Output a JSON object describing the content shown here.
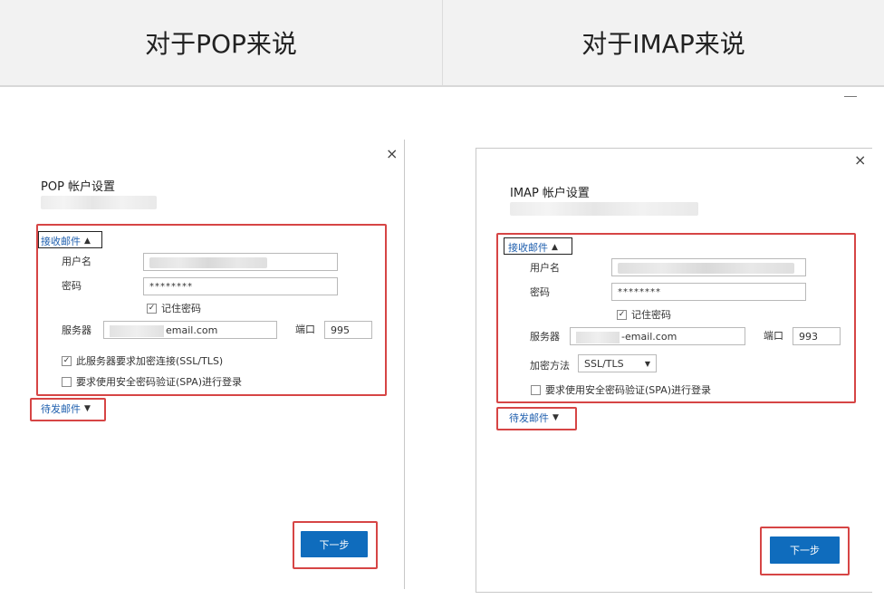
{
  "header": {
    "left": "对于POP来说",
    "right": "对于IMAP来说"
  },
  "pop": {
    "title": "POP 帐户设置",
    "incoming_label": "接收邮件",
    "username_label": "用户名",
    "password_label": "密码",
    "password_value": "********",
    "remember_label": "记住密码",
    "server_label": "服务器",
    "server_value": "email.com",
    "port_label": "端口",
    "port_value": "995",
    "ssl_label": "此服务器要求加密连接(SSL/TLS)",
    "spa_label": "要求使用安全密码验证(SPA)进行登录",
    "outgoing_label": "待发邮件",
    "next_label": "下一步",
    "close_glyph": "×"
  },
  "imap": {
    "title": "IMAP 帐户设置",
    "incoming_label": "接收邮件",
    "username_label": "用户名",
    "password_label": "密码",
    "password_value": "********",
    "remember_label": "记住密码",
    "server_label": "服务器",
    "server_value": "-email.com",
    "port_label": "端口",
    "port_value": "993",
    "encryption_label": "加密方法",
    "encryption_value": "SSL/TLS",
    "spa_label": "要求使用安全密码验证(SPA)进行登录",
    "outgoing_label": "待发邮件",
    "next_label": "下一步",
    "close_glyph": "×"
  },
  "colors": {
    "highlight_red": "#d64545",
    "button_blue": "#0f6cbd",
    "link_blue": "#1f5fae"
  },
  "icons": {
    "close": "close-icon",
    "chevron_up": "chevron-up-icon",
    "chevron_down": "chevron-down-icon",
    "check": "checkmark-icon",
    "minimize": "minimize-icon"
  }
}
